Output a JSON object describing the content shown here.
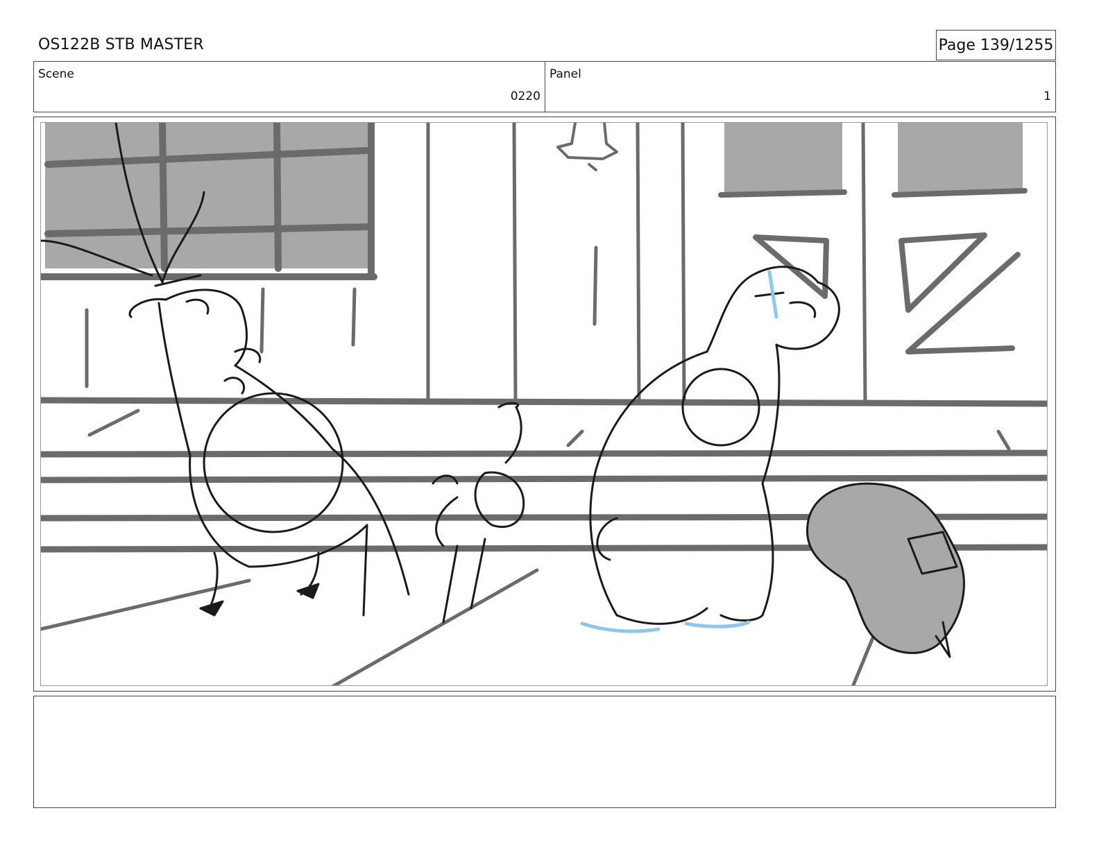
{
  "header": {
    "doc_title": "OS122B STB MASTER",
    "page_word": "Page",
    "page_number": "139/1255"
  },
  "info": {
    "scene_label": "Scene",
    "scene_value": "0220",
    "panel_label": "Panel",
    "panel_value": "1"
  },
  "frame": {
    "description_icon": "storyboard-sketch",
    "colors": {
      "line": "#1a1a1a",
      "gray": "#a8a8a8",
      "dark_gray": "#6b6b6b",
      "blue": "#8cc8ee"
    }
  },
  "notes": {
    "text": ""
  }
}
